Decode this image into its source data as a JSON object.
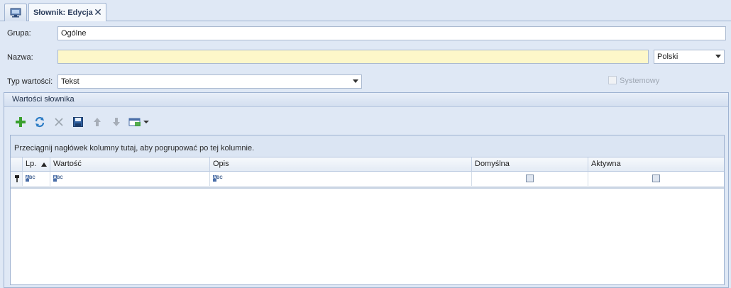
{
  "tabs": {
    "home_icon": "monitor-icon",
    "active_label": "Słownik: Edycja",
    "close_icon": "close-icon"
  },
  "form": {
    "grupa_label": "Grupa:",
    "grupa_value": "Ogólne",
    "nazwa_label": "Nazwa:",
    "nazwa_value": "",
    "language_value": "Polski",
    "typ_label": "Typ wartości:",
    "typ_value": "Tekst",
    "systemowy_label": "Systemowy",
    "systemowy_checked": false
  },
  "group": {
    "title": "Wartości słownika",
    "toolbar": [
      "add-icon",
      "refresh-icon",
      "delete-icon",
      "save-icon",
      "move-up-icon",
      "move-down-icon",
      "view-options-icon"
    ]
  },
  "grid": {
    "group_hint": "Przeciągnij nagłówek kolumny tutaj, aby pogrupować po tej kolumnie.",
    "columns": [
      "Lp.",
      "Wartość",
      "Opis",
      "Domyślna",
      "Aktywna"
    ],
    "sort_column": "Lp.",
    "sort_direction": "ascending",
    "new_row_icon": "pin-icon",
    "abc_letter": "A",
    "abc_rest": "BC"
  },
  "colors": {
    "background": "#dfe8f5",
    "required_field": "#fdf7c9",
    "add_green": "#3aa02e",
    "refresh_blue": "#2b7bc4"
  }
}
